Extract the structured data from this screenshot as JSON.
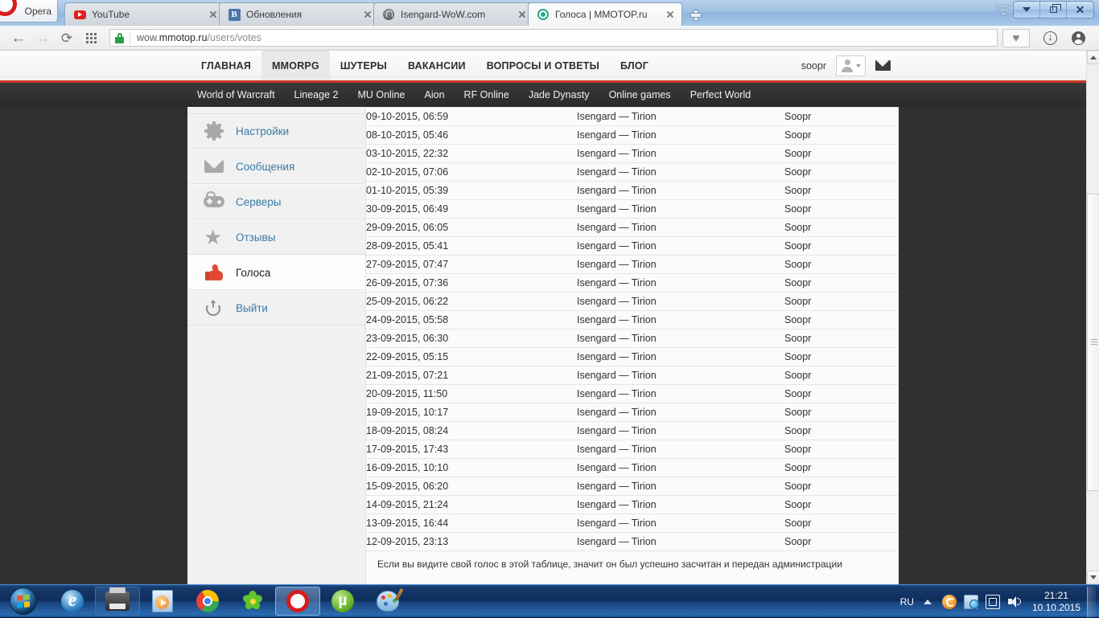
{
  "browser": {
    "name": "Opera",
    "menu_label": "Opera",
    "tabs": [
      {
        "title": "YouTube",
        "favicon": "youtube-icon",
        "active": false
      },
      {
        "title": "Обновления",
        "favicon": "vk-icon",
        "active": false
      },
      {
        "title": "Isengard-WoW.com",
        "favicon": "isengard-icon",
        "active": false
      },
      {
        "title": "Голоса | MMOTOP.ru",
        "favicon": "mmotop-icon",
        "active": true
      }
    ],
    "new_tab_label": "+",
    "window_controls": {
      "minimize": "▼",
      "restore": "❐",
      "close": "✕"
    },
    "toolbar": {
      "back": "←",
      "forward": "→",
      "reload": "⟳",
      "apps": "apps-grid-icon",
      "heart": "♥",
      "download": "↓",
      "account": "account-icon"
    },
    "address": {
      "url_prefix": "wow.",
      "url_host": "mmotop.ru",
      "url_path": "/users/votes",
      "secure": true
    }
  },
  "site": {
    "header": {
      "nav": [
        {
          "label": "ГЛАВНАЯ",
          "active": false
        },
        {
          "label": "MMORPG",
          "active": true
        },
        {
          "label": "ШУТЕРЫ",
          "active": false
        },
        {
          "label": "ВАКАНСИИ",
          "active": false
        },
        {
          "label": "ВОПРОСЫ И ОТВЕТЫ",
          "active": false
        },
        {
          "label": "БЛОГ",
          "active": false
        }
      ],
      "username": "soopr",
      "accent_color": "#cf3a21"
    },
    "subnav": [
      "World of Warcraft",
      "Lineage 2",
      "MU Online",
      "Aion",
      "RF Online",
      "Jade Dynasty",
      "Online games",
      "Perfect World"
    ],
    "sidebar": [
      {
        "label": "Настройки",
        "icon": "gear-icon",
        "active": false
      },
      {
        "label": "Сообщения",
        "icon": "envelope-icon",
        "active": false
      },
      {
        "label": "Серверы",
        "icon": "gamepad-icon",
        "active": false
      },
      {
        "label": "Отзывы",
        "icon": "star-icon",
        "active": false
      },
      {
        "label": "Голоса",
        "icon": "thumbs-up-icon",
        "active": true
      },
      {
        "label": "Выйти",
        "icon": "power-icon",
        "active": false
      }
    ],
    "votes_table": {
      "rows": [
        {
          "date": "09-10-2015, 06:59",
          "server": "Isengard — Tirion",
          "user": "Soopr"
        },
        {
          "date": "08-10-2015, 05:46",
          "server": "Isengard — Tirion",
          "user": "Soopr"
        },
        {
          "date": "03-10-2015, 22:32",
          "server": "Isengard — Tirion",
          "user": "Soopr"
        },
        {
          "date": "02-10-2015, 07:06",
          "server": "Isengard — Tirion",
          "user": "Soopr"
        },
        {
          "date": "01-10-2015, 05:39",
          "server": "Isengard — Tirion",
          "user": "Soopr"
        },
        {
          "date": "30-09-2015, 06:49",
          "server": "Isengard — Tirion",
          "user": "Soopr"
        },
        {
          "date": "29-09-2015, 06:05",
          "server": "Isengard — Tirion",
          "user": "Soopr"
        },
        {
          "date": "28-09-2015, 05:41",
          "server": "Isengard — Tirion",
          "user": "Soopr"
        },
        {
          "date": "27-09-2015, 07:47",
          "server": "Isengard — Tirion",
          "user": "Soopr"
        },
        {
          "date": "26-09-2015, 07:36",
          "server": "Isengard — Tirion",
          "user": "Soopr"
        },
        {
          "date": "25-09-2015, 06:22",
          "server": "Isengard — Tirion",
          "user": "Soopr"
        },
        {
          "date": "24-09-2015, 05:58",
          "server": "Isengard — Tirion",
          "user": "Soopr"
        },
        {
          "date": "23-09-2015, 06:30",
          "server": "Isengard — Tirion",
          "user": "Soopr"
        },
        {
          "date": "22-09-2015, 05:15",
          "server": "Isengard — Tirion",
          "user": "Soopr"
        },
        {
          "date": "21-09-2015, 07:21",
          "server": "Isengard — Tirion",
          "user": "Soopr"
        },
        {
          "date": "20-09-2015, 11:50",
          "server": "Isengard — Tirion",
          "user": "Soopr"
        },
        {
          "date": "19-09-2015, 10:17",
          "server": "Isengard — Tirion",
          "user": "Soopr"
        },
        {
          "date": "18-09-2015, 08:24",
          "server": "Isengard — Tirion",
          "user": "Soopr"
        },
        {
          "date": "17-09-2015, 17:43",
          "server": "Isengard — Tirion",
          "user": "Soopr"
        },
        {
          "date": "16-09-2015, 10:10",
          "server": "Isengard — Tirion",
          "user": "Soopr"
        },
        {
          "date": "15-09-2015, 06:20",
          "server": "Isengard — Tirion",
          "user": "Soopr"
        },
        {
          "date": "14-09-2015, 21:24",
          "server": "Isengard — Tirion",
          "user": "Soopr"
        },
        {
          "date": "13-09-2015, 16:44",
          "server": "Isengard — Tirion",
          "user": "Soopr"
        },
        {
          "date": "12-09-2015, 23:13",
          "server": "Isengard — Tirion",
          "user": "Soopr"
        }
      ],
      "note": "Если вы видите свой голос в этой таблице, значит он был успешно засчитан и передан администрации"
    }
  },
  "taskbar": {
    "start": "start-orb",
    "items": [
      {
        "name": "internet-explorer",
        "active": false
      },
      {
        "name": "printer-scanner",
        "active": false,
        "boxed": true
      },
      {
        "name": "windows-media-player",
        "active": false
      },
      {
        "name": "google-chrome",
        "active": false
      },
      {
        "name": "icq",
        "active": false
      },
      {
        "name": "opera",
        "active": true
      },
      {
        "name": "utorrent",
        "active": false
      },
      {
        "name": "paint",
        "active": false
      }
    ],
    "tray": {
      "language": "RU",
      "time": "21:21",
      "date": "10.10.2015"
    }
  }
}
